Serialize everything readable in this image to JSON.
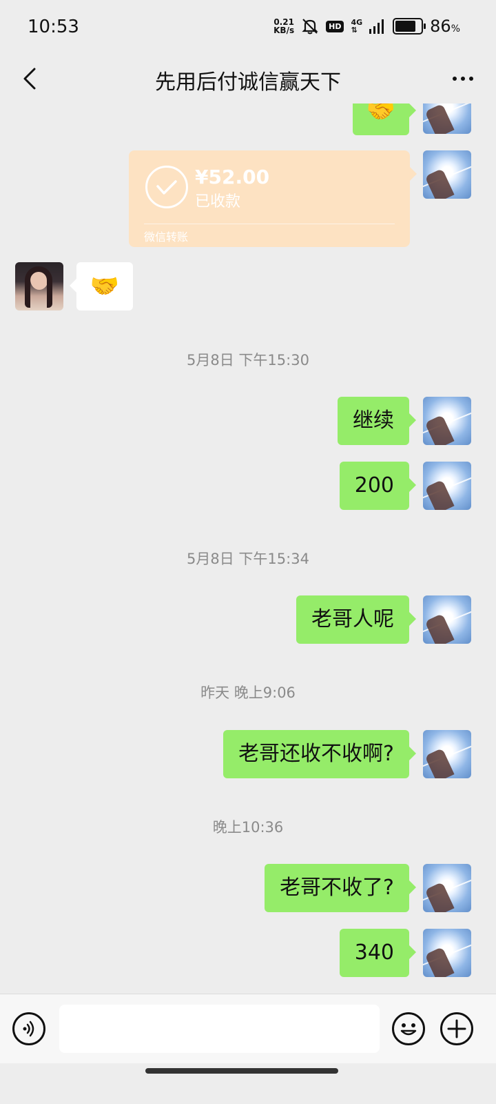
{
  "status_bar": {
    "time": "10:53",
    "network_speed_top": "0.21",
    "network_speed_bottom": "KB/s",
    "hd_badge": "HD",
    "network_type": "4G",
    "battery_percent": "86",
    "battery_unit": "%",
    "battery_level": 0.86
  },
  "header": {
    "title": "先用后付诚信赢天下"
  },
  "messages": {
    "sticker_top": "🤝",
    "transfer": {
      "amount": "¥52.00",
      "status": "已收款",
      "label": "微信转账",
      "accent_color": "#fde2c2"
    },
    "her_sticker": "🤝",
    "ts1": "5月8日 下午15:30",
    "m1": "继续",
    "m2": "200",
    "ts2": "5月8日 下午15:34",
    "m3": "老哥人呢",
    "ts3": "昨天 晚上9:06",
    "m4": "老哥还收不收啊?",
    "ts4": "晚上10:36",
    "m5": "老哥不收了?",
    "m6": "340"
  },
  "input_bar": {
    "placeholder": "",
    "value": ""
  },
  "colors": {
    "my_bubble": "#95ec69",
    "background": "#ededed"
  }
}
